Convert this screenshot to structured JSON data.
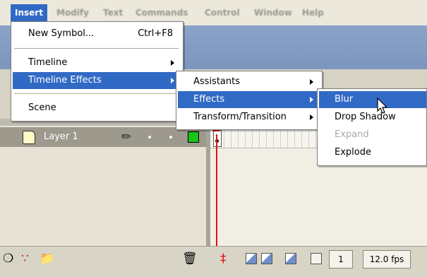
{
  "menubar": {
    "items": [
      "Insert",
      "Modify",
      "Text",
      "Commands",
      "Control",
      "Window",
      "Help"
    ]
  },
  "insert_menu": {
    "new_symbol": {
      "label": "New Symbol...",
      "shortcut": "Ctrl+F8"
    },
    "timeline": "Timeline",
    "timeline_effects": "Timeline Effects",
    "scene": "Scene"
  },
  "timeline_effects_menu": {
    "items": [
      "Assistants",
      "Effects",
      "Transform/Transition"
    ]
  },
  "effects_menu": {
    "items": [
      "Blur",
      "Drop Shadow",
      "Expand",
      "Explode"
    ]
  },
  "layer": {
    "name": "Layer 1"
  },
  "status": {
    "current_frame": "1",
    "frame_rate": "12.0 fps"
  },
  "colors": {
    "highlight": "#316ac5",
    "layer_indicator": "#19c419",
    "playhead": "#e01010"
  },
  "icons": [
    "pencil-icon",
    "trash-icon",
    "add-layer-icon",
    "add-motion-guide-icon",
    "add-folder-icon",
    "onion-skin-icon",
    "mouse-pointer-icon"
  ]
}
